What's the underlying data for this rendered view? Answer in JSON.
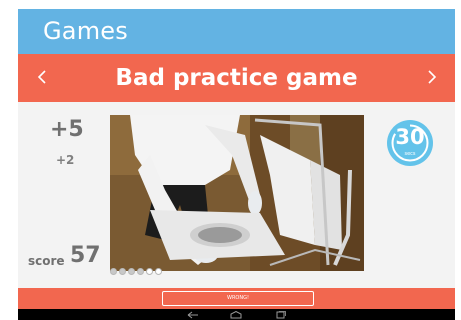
{
  "app_bar": {
    "title": "Games"
  },
  "game_bar": {
    "title": "Bad practice game",
    "prev_icon": "chevron-left-icon",
    "next_icon": "chevron-right-icon"
  },
  "points": {
    "main": "+5",
    "sub": "+2"
  },
  "score": {
    "label": "score",
    "value": "57"
  },
  "timer": {
    "value": "30",
    "unit": "secs",
    "fraction_remaining": 0.85,
    "color": "#63c3ea"
  },
  "progress_dots": {
    "total": 6,
    "filled": 4
  },
  "feedback": {
    "button_label": "WRONG!"
  },
  "nav_icons": [
    "back-icon",
    "home-icon",
    "recent-apps-icon"
  ],
  "colors": {
    "app_bar": "#63b3e3",
    "game_bar": "#f2674f",
    "background": "#f3f3f3"
  }
}
